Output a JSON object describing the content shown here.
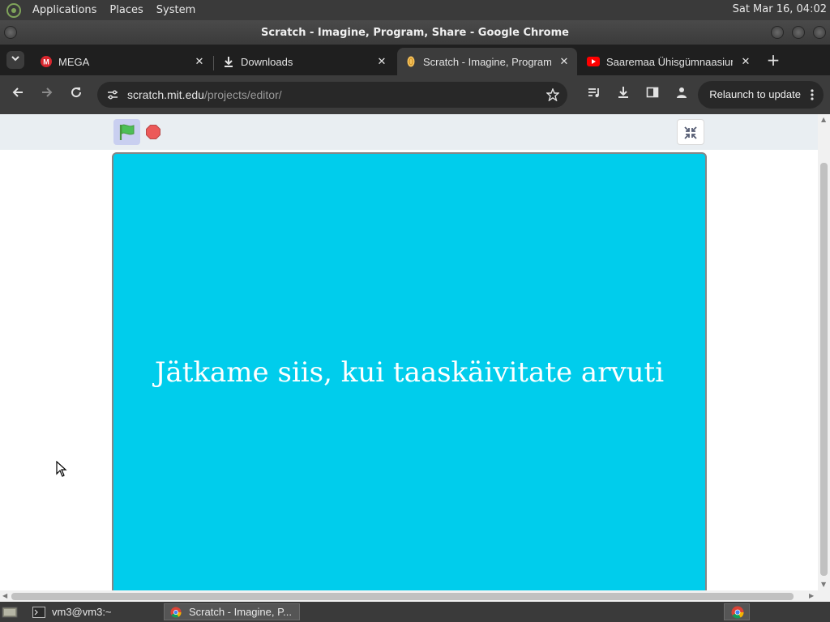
{
  "system_panel": {
    "menus": [
      "Applications",
      "Places",
      "System"
    ],
    "clock": "Sat Mar 16, 04:02"
  },
  "window": {
    "title": "Scratch - Imagine, Program, Share - Google Chrome"
  },
  "tabs": [
    {
      "label": "MEGA",
      "icon": "mega-icon"
    },
    {
      "label": "Downloads",
      "icon": "download-icon"
    },
    {
      "label": "Scratch - Imagine, Program, Share",
      "icon": "scratch-icon",
      "active": true
    },
    {
      "label": "Saaremaa Ühisgümnaasium",
      "icon": "youtube-icon"
    }
  ],
  "toolbar": {
    "url_host": "scratch.mit.edu",
    "url_path": "/projects/editor/",
    "relaunch_label": "Relaunch to update"
  },
  "stage": {
    "message": "Jätkame siis, kui taaskäivitate arvuti",
    "background_color": "#00cdec"
  },
  "taskbar": {
    "items": [
      {
        "label": "vm3@vm3:~",
        "icon": "terminal-icon"
      },
      {
        "label": "Scratch - Imagine, P...",
        "icon": "chrome-icon",
        "active": true
      }
    ]
  }
}
